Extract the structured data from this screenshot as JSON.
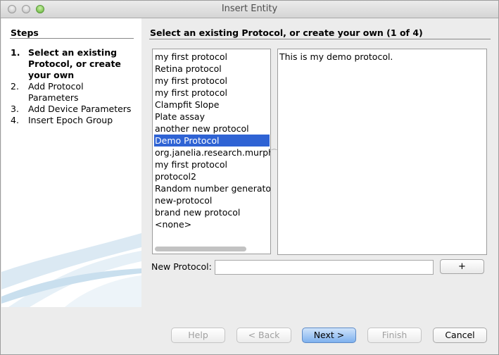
{
  "window": {
    "title": "Insert Entity"
  },
  "steps": {
    "heading": "Steps",
    "items": [
      {
        "number": "1.",
        "label": "Select an existing Protocol, or create your own",
        "active": true
      },
      {
        "number": "2.",
        "label": "Add Protocol Parameters",
        "active": false
      },
      {
        "number": "3.",
        "label": "Add Device Parameters",
        "active": false
      },
      {
        "number": "4.",
        "label": "Insert Epoch Group",
        "active": false
      }
    ]
  },
  "main": {
    "heading": "Select an existing Protocol, or create your own (1 of 4)",
    "protocols": [
      "my first protocol",
      "Retina protocol",
      "my first protocol",
      "my first protocol",
      "Clampfit Slope",
      "Plate assay",
      "another new protocol",
      "Demo Protocol",
      "org.janelia.research.murphy",
      "my first protocol",
      "protocol2",
      "Random number generator",
      "new-protocol",
      "brand new protocol",
      "<none>"
    ],
    "selected_protocol": "Demo Protocol",
    "description": "This is my demo protocol.",
    "new_protocol_label": "New Protocol:",
    "new_protocol_value": "",
    "add_label": "+"
  },
  "buttons": {
    "help": "Help",
    "back": "< Back",
    "next": "Next >",
    "finish": "Finish",
    "cancel": "Cancel"
  },
  "colors": {
    "selection": "#2f63d4",
    "default_button": "#7fb1ee"
  }
}
